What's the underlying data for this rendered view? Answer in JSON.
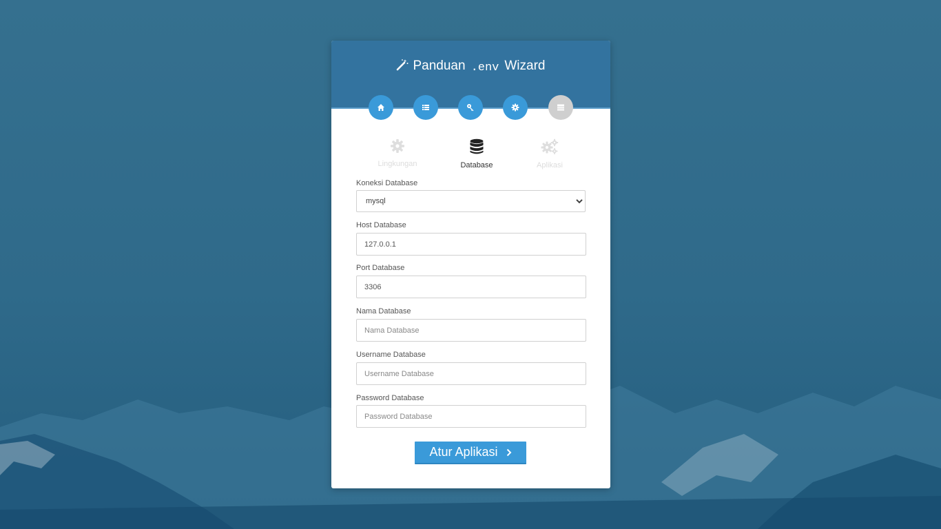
{
  "header": {
    "title_prefix": "Panduan",
    "title_code": ".env",
    "title_suffix": "Wizard",
    "wand_icon": "magic-wand-icon"
  },
  "steps": [
    {
      "icon": "home-icon",
      "state": "active"
    },
    {
      "icon": "list-icon",
      "state": "active"
    },
    {
      "icon": "key-icon",
      "state": "active"
    },
    {
      "icon": "gear-icon",
      "state": "active"
    },
    {
      "icon": "server-icon",
      "state": "inactive"
    }
  ],
  "tabs": [
    {
      "label": "Lingkungan",
      "icon": "gear-icon",
      "active": false
    },
    {
      "label": "Database",
      "icon": "database-icon",
      "active": true
    },
    {
      "label": "Aplikasi",
      "icon": "gears-icon",
      "active": false
    }
  ],
  "form": {
    "connection": {
      "label": "Koneksi Database",
      "options": [
        "mysql"
      ],
      "value": "mysql"
    },
    "host": {
      "label": "Host Database",
      "value": "127.0.0.1"
    },
    "port": {
      "label": "Port Database",
      "value": "3306"
    },
    "name": {
      "label": "Nama Database",
      "placeholder": "Nama Database",
      "value": ""
    },
    "username": {
      "label": "Username Database",
      "placeholder": "Username Database",
      "value": ""
    },
    "password": {
      "label": "Password Database",
      "placeholder": "Password Database",
      "value": ""
    }
  },
  "submit": {
    "label": "Atur Aplikasi",
    "icon": "chevron-right-icon"
  },
  "colors": {
    "accent": "#3a9ad9",
    "header": "#33739f",
    "background": "#2f6a8a",
    "inactive_step": "#cfcfcf"
  }
}
